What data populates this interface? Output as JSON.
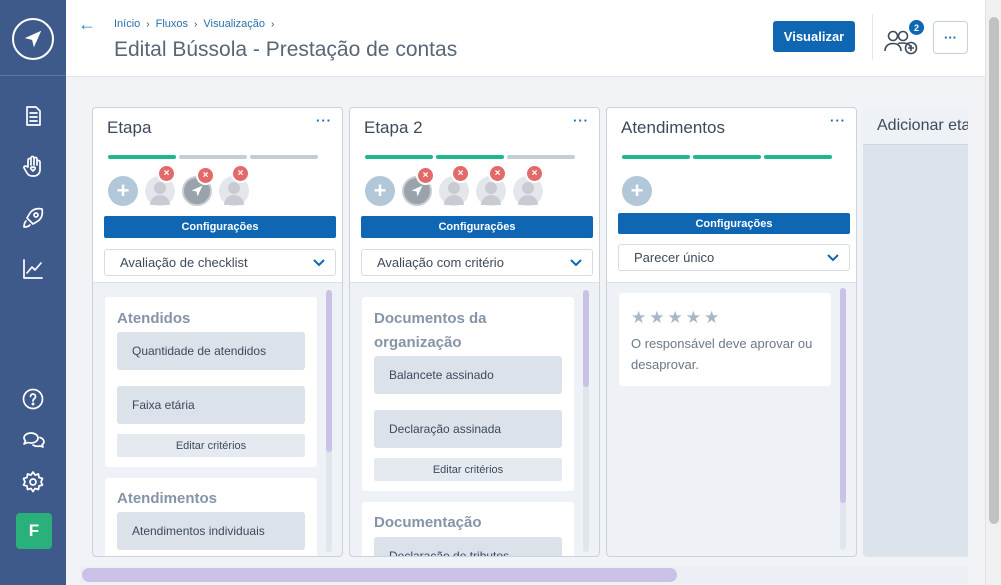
{
  "sidebar": {
    "logo_icon": "compass-logo-icon",
    "nav": [
      {
        "icon": "document-icon"
      },
      {
        "icon": "hand-heart-icon"
      },
      {
        "icon": "rocket-icon"
      },
      {
        "icon": "chart-line-icon"
      }
    ],
    "bottom": [
      {
        "icon": "help-icon"
      },
      {
        "icon": "chat-icon"
      },
      {
        "icon": "gear-icon"
      }
    ],
    "avatar_letter": "F",
    "avatar_color": "#29b07b"
  },
  "header": {
    "breadcrumb": [
      "Início",
      "Fluxos",
      "Visualização"
    ],
    "title": "Edital Bússola - Prestação de contas",
    "visualizar_label": "Visualizar",
    "users_badge": "2",
    "more_label": "···"
  },
  "columns": [
    {
      "title": "Etapa",
      "more": "···",
      "config_label": "Configurações",
      "select_value": "Avaliação de checklist",
      "progress": {
        "filled": 1,
        "total": 3
      },
      "cards": [
        {
          "title": "Atendidos",
          "criteria": [
            "Quantidade de atendidos",
            "Faixa etária"
          ],
          "edit_label": "Editar critérios"
        },
        {
          "title": "Atendimentos",
          "criteria": [
            "Atendimentos individuais"
          ]
        }
      ]
    },
    {
      "title": "Etapa 2",
      "more": "···",
      "config_label": "Configurações",
      "select_value": "Avaliação com critério",
      "progress": {
        "filled": 2,
        "total": 3
      },
      "cards": [
        {
          "title": "Documentos da organização",
          "criteria": [
            "Balancete assinado",
            "Declaração assinada"
          ],
          "edit_label": "Editar critérios"
        },
        {
          "title": "Documentação",
          "criteria": [
            "Declaração de tributos"
          ]
        }
      ]
    },
    {
      "title": "Atendimentos",
      "more": "···",
      "config_label": "Configurações",
      "select_value": "Parecer único",
      "progress": {
        "filled": 3,
        "total": 3
      },
      "parecer_text": "O responsável deve aprovar ou desaprovar.",
      "stars": 5
    }
  ],
  "add_column_label": "Adicionar etapa",
  "colors": {
    "primary": "#0f66b3",
    "sidebar": "#3e5a8a",
    "progress_on": "#1fb88a",
    "remove_badge": "#e26a6a"
  }
}
